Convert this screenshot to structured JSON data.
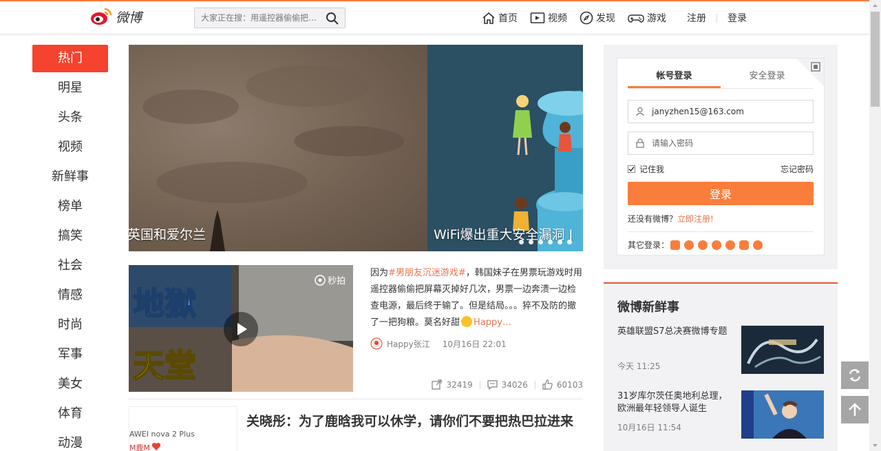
{
  "header": {
    "logo_text": "微博",
    "search_placeholder": "大家正在搜：用遥控器偷偷把…",
    "nav": [
      {
        "label": "首页",
        "icon": "home-icon"
      },
      {
        "label": "视频",
        "icon": "video-icon"
      },
      {
        "label": "发现",
        "icon": "compass-icon"
      },
      {
        "label": "游戏",
        "icon": "gamepad-icon"
      }
    ],
    "register_label": "注册",
    "login_label": "登录"
  },
  "categories": [
    "热门",
    "明星",
    "头条",
    "视频",
    "新鲜事",
    "榜单",
    "搞笑",
    "社会",
    "情感",
    "时尚",
    "军事",
    "美女",
    "体育",
    "动漫"
  ],
  "banner": {
    "caption_left": "英国和爱尔兰",
    "caption_right": "WiFi爆出重大安全漏洞 J",
    "dot_count": 6
  },
  "feed1": {
    "thumb_text_top": "地獄",
    "thumb_text_bottom": "天堂",
    "thumb_badge": "秒拍",
    "text_prefix": "因为",
    "text_tag": "#男朋友沉迷游戏#",
    "text_body": "，韩国妹子在男票玩游戏时用遥控器偷偷把屏幕灭掉好几次，男票一边奔溃一边检查电源，最后终于输了。但是结局。。。猝不及防的撤了一把狗粮。莫名好甜",
    "text_tail": "Happy…",
    "author": "Happy张江",
    "time": "10月16日 22:01",
    "shares": "32419",
    "comments": "34026",
    "likes": "60103"
  },
  "feed2": {
    "thumb_line1": "AWEI nova 2 Plus",
    "thumb_line2": "M鹿M",
    "title": "关晓彤：为了鹿晗我可以休学，请你们不要把热巴拉进来"
  },
  "login": {
    "tab_account": "帐号登录",
    "tab_secure": "安全登录",
    "username_value": "janyzhen15@163.com",
    "password_placeholder": "请输入密码",
    "remember_label": "记住我",
    "forgot_label": "忘记密码",
    "login_button": "登录",
    "no_account": "还没有微博？",
    "register_now": "立即注册!",
    "other_login": "其它登录：",
    "other_count": 7
  },
  "news": {
    "title": "微博新鲜事",
    "items": [
      {
        "text": "英雄联盟S7总决赛微博专题",
        "time": "今天 11:25"
      },
      {
        "text": "31岁库尔茨任奥地利总理，欧洲最年轻领导人诞生",
        "time": "10月16日 11:54"
      }
    ]
  },
  "colors": {
    "accent": "#fa7d3c",
    "hot_red": "#f5432f",
    "tag_orange": "#eb7350"
  }
}
